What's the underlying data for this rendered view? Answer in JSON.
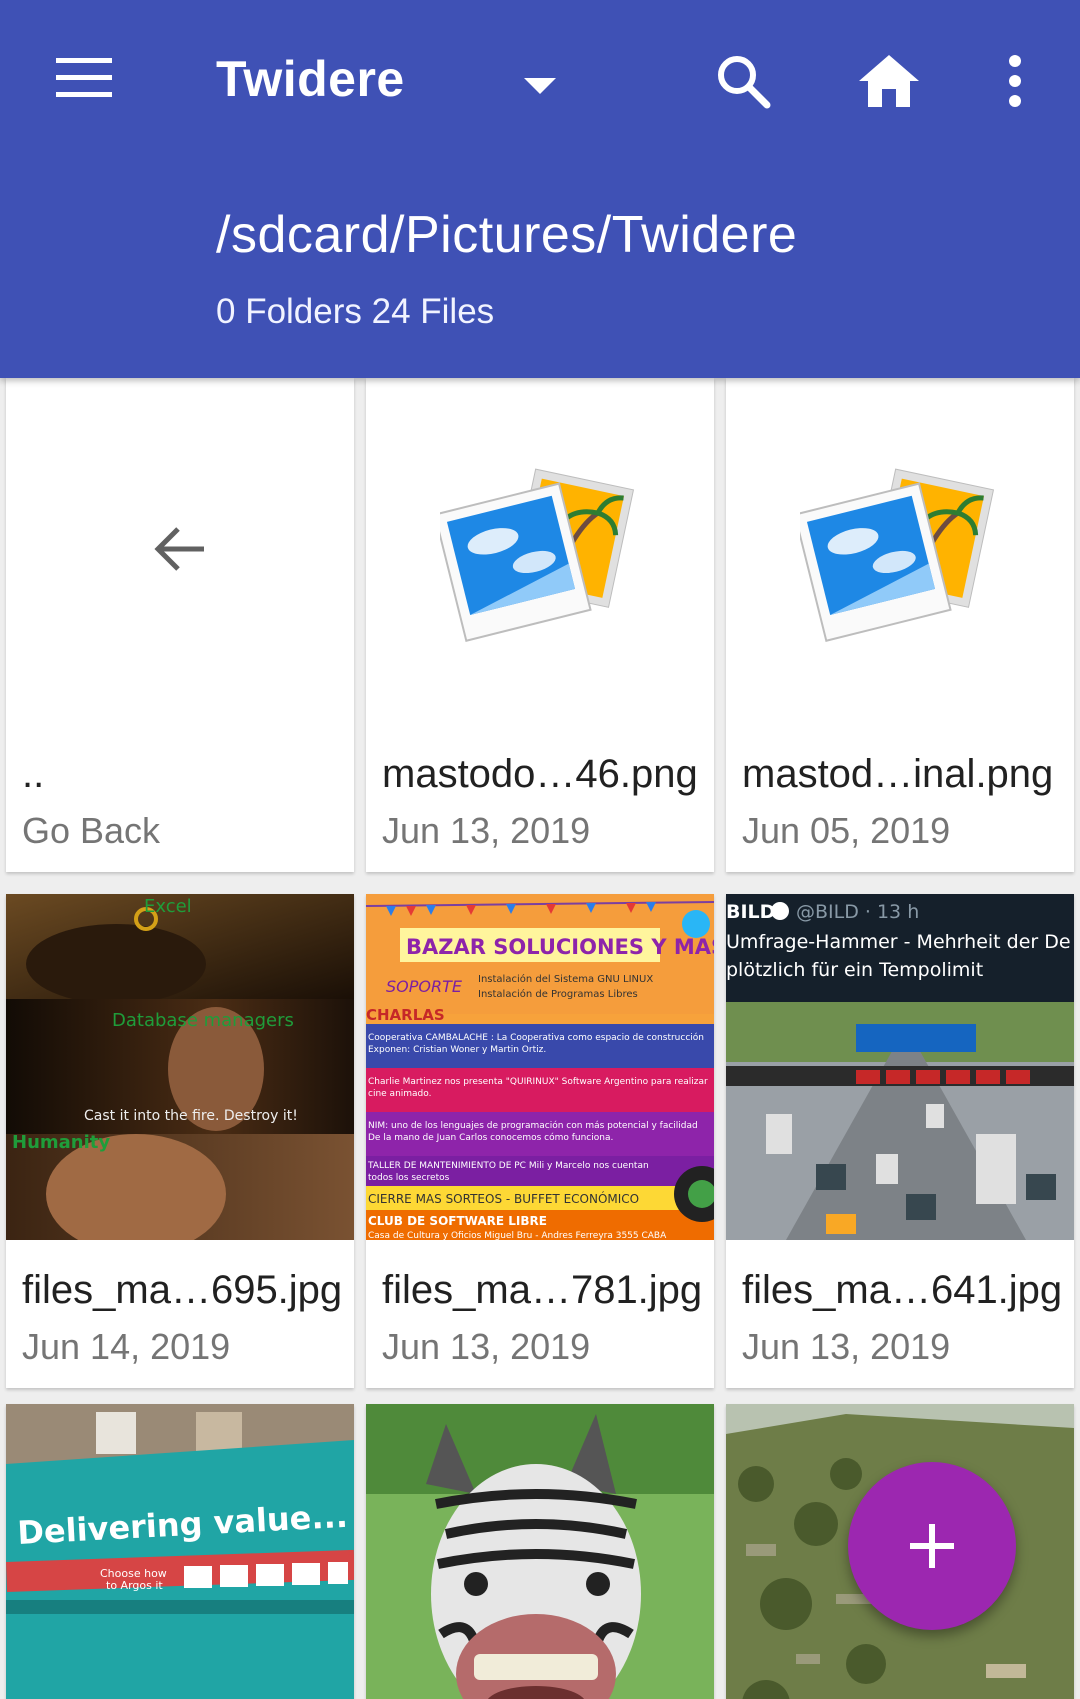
{
  "header": {
    "title": "Twidere",
    "path": "/sdcard/Pictures/Twidere",
    "summary": "0 Folders 24 Files",
    "icons": [
      "menu-icon",
      "chevron-down-icon",
      "search-icon",
      "home-icon",
      "more-vert-icon"
    ],
    "background_color": "#3f51b5"
  },
  "items": [
    {
      "name": "..",
      "date": "Go Back",
      "thumb": "back-arrow-icon"
    },
    {
      "name": "mastodo…46.png",
      "date": "Jun 13, 2019",
      "thumb": "image-placeholder-icon"
    },
    {
      "name": "mastod…inal.png",
      "date": "Jun 05, 2019",
      "thumb": "image-placeholder-icon"
    },
    {
      "name": "files_ma…695.jpg",
      "date": "Jun 14, 2019",
      "thumb": "meme-thumbnail"
    },
    {
      "name": "files_ma…781.jpg",
      "date": "Jun 13, 2019",
      "thumb": "flyer-thumbnail"
    },
    {
      "name": "files_ma…641.jpg",
      "date": "Jun 13, 2019",
      "thumb": "tweet-thumbnail"
    },
    {
      "name": "",
      "date": "",
      "thumb": "truck-thumbnail"
    },
    {
      "name": "",
      "date": "",
      "thumb": "zebra-thumbnail"
    },
    {
      "name": "",
      "date": "",
      "thumb": "landscape-thumbnail"
    }
  ],
  "thumbnails": {
    "meme": {
      "top": "Excel",
      "middle": "Database managers",
      "caption": "Cast it into the fire. Destroy it!",
      "bottom": "Humanity"
    },
    "flyer": {
      "title": "BAZAR SOLUCIONES Y MAS",
      "side": "SOPORTE",
      "lines_top": [
        "Instalación del Sistema GNU LINUX",
        "Instalación de Programas Libres"
      ],
      "charlas": "CHARLAS",
      "talks": [
        "Cooperativa CAMBALACHE : La Cooperativa como espacio de construcción",
        "Exponen: Cristian Woner y Martin Ortiz.",
        "Charlie Martinez nos presenta \"QUIRINUX\" Software Argentino para realizar",
        "cine animado.",
        "NIM: uno de los lenguajes de programación con más potencial y facilidad",
        "De la mano de Juan Carlos conocemos cómo funciona.",
        "TALLER DE MANTENIMIENTO DE PC Mili y Marcelo nos cuentan",
        "todos los secretos"
      ],
      "bottom1": "CIERRE MAS SORTEOS - BUFFET ECONÓMICO",
      "bottom2": "CLUB DE SOFTWARE LIBRE",
      "bottom3": "Casa de Cultura y Oficios Miguel Bru - Andres Ferreyra 3555 CABA"
    },
    "tweet": {
      "account": "BILD",
      "handle": "@BILD · 13 h",
      "line1": "Umfrage-Hammer - Mehrheit der De",
      "line2": "plötzlich für ein Tempolimit"
    },
    "truck": {
      "slogan": "Delivering value...",
      "sub1": "Choose how",
      "sub2": "to Argos it"
    }
  },
  "fab": {
    "icon": "add-icon",
    "color": "#9c27b0"
  }
}
